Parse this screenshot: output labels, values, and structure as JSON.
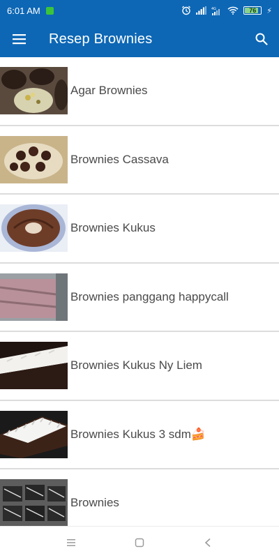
{
  "status_bar": {
    "time": "6:01 AM",
    "battery": "76",
    "icons": [
      "notification-icon",
      "alarm-icon",
      "signal-icon",
      "signal-4g-icon",
      "wifi-icon",
      "battery-icon",
      "charging-icon"
    ]
  },
  "app_bar": {
    "title": "Resep Brownies",
    "menu_icon": "hamburger-menu-icon",
    "search_icon": "search-icon",
    "color": "#0d67b5"
  },
  "recipes": [
    {
      "label": "Agar Brownies"
    },
    {
      "label": "Brownies Cassava"
    },
    {
      "label": "Brownies Kukus"
    },
    {
      "label": "Brownies panggang happycall"
    },
    {
      "label": "Brownies Kukus Ny Liem"
    },
    {
      "label": "Brownies Kukus 3 sdm🍰"
    },
    {
      "label": "Brownies"
    }
  ],
  "nav_bar": {
    "icons": [
      "recents-icon",
      "home-icon",
      "back-icon"
    ]
  }
}
